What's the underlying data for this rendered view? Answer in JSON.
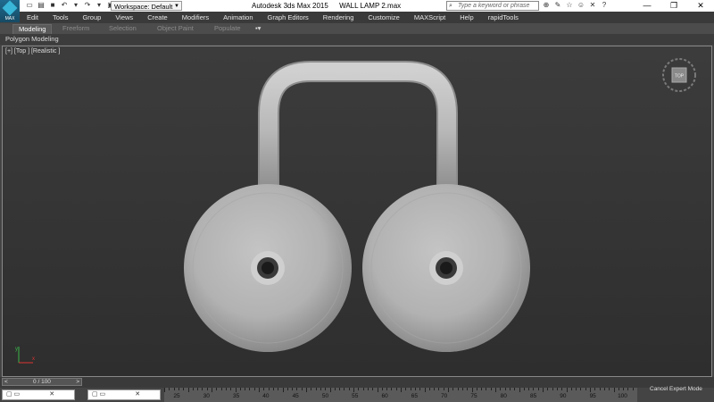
{
  "app": {
    "logo_text": "MAX",
    "title": "Autodesk 3ds Max  2015",
    "file": "WALL LAMP 2.max"
  },
  "workspace": {
    "label": "Workspace: Default"
  },
  "search": {
    "placeholder": "Type a keyword or phrase"
  },
  "menu": [
    "Edit",
    "Tools",
    "Group",
    "Views",
    "Create",
    "Modifiers",
    "Animation",
    "Graph Editors",
    "Rendering",
    "Customize",
    "MAXScript",
    "Help",
    "rapidTools"
  ],
  "ribbon": {
    "tabs": [
      "Modeling",
      "Freeform",
      "Selection",
      "Object Paint",
      "Populate"
    ],
    "active": "Modeling",
    "panel": "Polygon Modeling"
  },
  "viewport": {
    "label": "[+] [Top ] [Realistic ]",
    "cube_face": "TOP"
  },
  "time": {
    "slider": "0 / 100"
  },
  "timeline": {
    "labels": [
      "25",
      "30",
      "35",
      "40",
      "45",
      "50",
      "55",
      "60",
      "65",
      "70",
      "75",
      "80",
      "85",
      "90",
      "95",
      "100"
    ]
  },
  "status": {
    "expert": "Cancel Expert Mode"
  },
  "colors": {
    "accent": "#39b6d8",
    "viewport_bg": "#333333",
    "object": "#b8b8b8"
  }
}
